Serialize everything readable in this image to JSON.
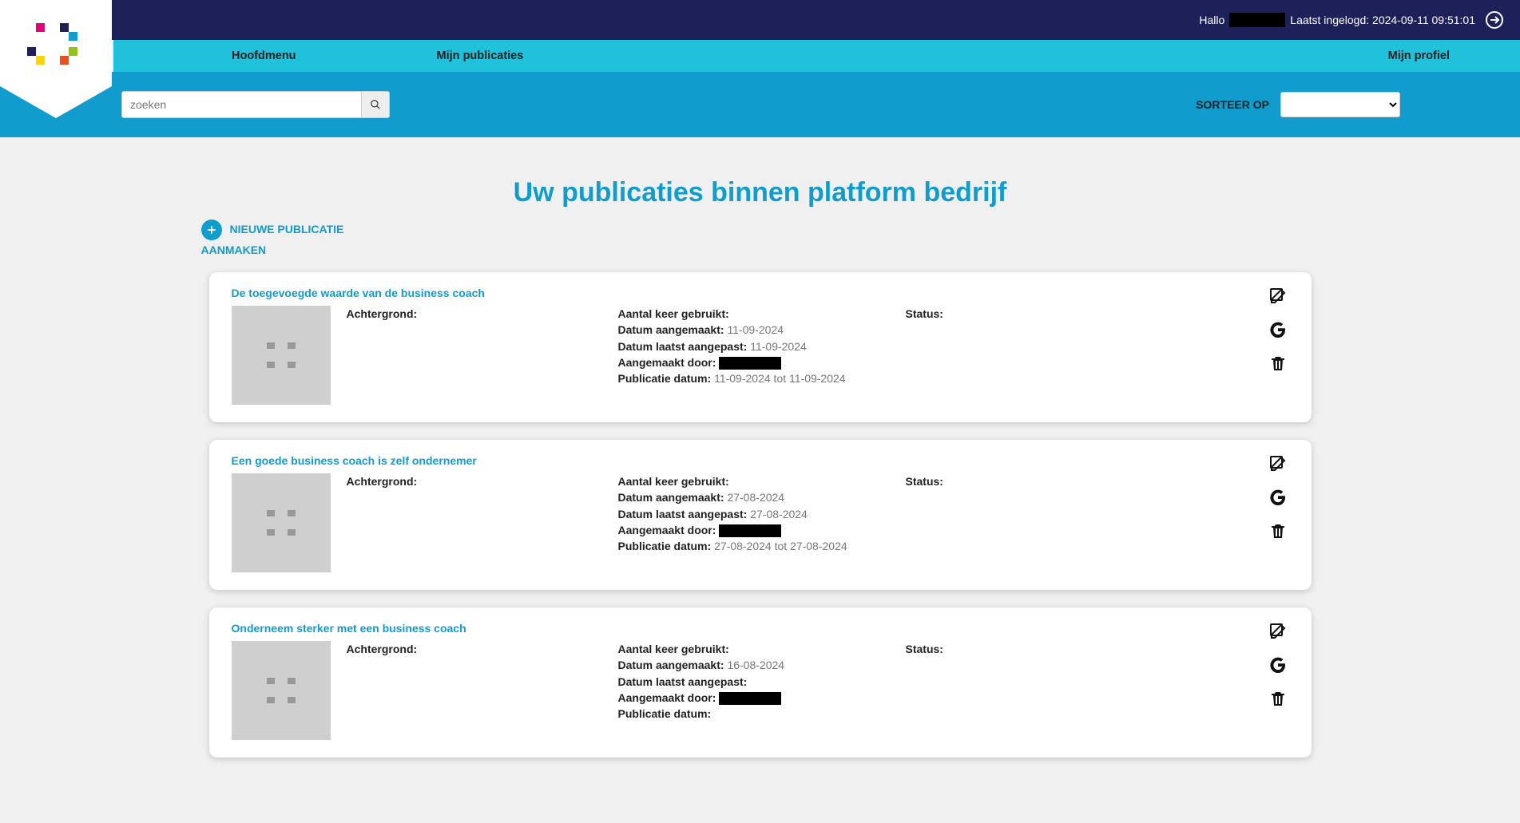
{
  "topbar": {
    "greeting": "Hallo",
    "lastlogin_prefix": "Laatst ingelogd:",
    "lastlogin_value": "2024-09-11 09:51:01"
  },
  "nav": {
    "hoofdmenu": "Hoofdmenu",
    "mijn_publicaties": "Mijn publicaties",
    "mijn_profiel": "Mijn profiel"
  },
  "search": {
    "placeholder": "zoeken"
  },
  "sort": {
    "label": "SORTEER OP"
  },
  "page": {
    "title": "Uw publicaties binnen platform bedrijf",
    "new_pub_line1": "NIEUWE PUBLICATIE",
    "new_pub_line2": "AANMAKEN"
  },
  "labels": {
    "achtergrond": "Achtergrond:",
    "aantal_keer": "Aantal keer gebruikt:",
    "datum_aangemaakt": "Datum aangemaakt:",
    "datum_aangepast": "Datum laatst aangepast:",
    "aangemaakt_door": "Aangemaakt door:",
    "publicatie_datum": "Publicatie datum:",
    "status": "Status:",
    "tot": "tot"
  },
  "cards": [
    {
      "title": "De toegevoegde waarde van de business coach",
      "datum_aangemaakt": "11-09-2024",
      "datum_aangepast": "11-09-2024",
      "pub_van": "11-09-2024",
      "pub_tot": "11-09-2024"
    },
    {
      "title": "Een goede business coach is zelf ondernemer",
      "datum_aangemaakt": "27-08-2024",
      "datum_aangepast": "27-08-2024",
      "pub_van": "27-08-2024",
      "pub_tot": "27-08-2024"
    },
    {
      "title": "Onderneem sterker met een business coach",
      "datum_aangemaakt": "16-08-2024",
      "datum_aangepast": "",
      "pub_van": "",
      "pub_tot": ""
    }
  ]
}
